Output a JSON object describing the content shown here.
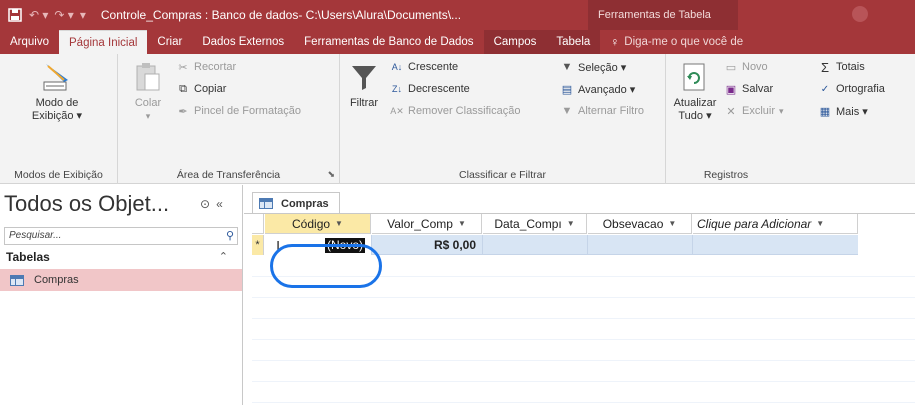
{
  "titlebar": {
    "title": "Controle_Compras : Banco de dados- C:\\Users\\Alura\\Documents\\...",
    "context_label": "Ferramentas de Tabela"
  },
  "tabs": [
    {
      "label": "Arquivo"
    },
    {
      "label": "Página Inicial"
    },
    {
      "label": "Criar"
    },
    {
      "label": "Dados Externos"
    },
    {
      "label": "Ferramentas de Banco de Dados"
    },
    {
      "label": "Campos"
    },
    {
      "label": "Tabela"
    },
    {
      "label": "Diga-me o que você de"
    }
  ],
  "ribbon": {
    "views": {
      "modo": "Modo de",
      "exibicao": "Exibição ▾",
      "group": "Modos de Exibição"
    },
    "clipboard": {
      "colar": "Colar",
      "recortar": "Recortar",
      "copiar": "Copiar",
      "pincel": "Pincel de Formatação",
      "group": "Área de Transferência"
    },
    "sort": {
      "filtrar": "Filtrar",
      "crescente": "Crescente",
      "decrescente": "Decrescente",
      "remover": "Remover Classificação",
      "selecao": "Seleção ▾",
      "avancado": "Avançado ▾",
      "alternar": "Alternar Filtro",
      "group": "Classificar e Filtrar"
    },
    "records": {
      "atualizar": "Atualizar",
      "tudo": "Tudo ▾",
      "novo": "Novo",
      "salvar": "Salvar",
      "excluir": "Excluir",
      "totais": "Totais",
      "ortografia": "Ortografia",
      "mais": "Mais ▾",
      "group": "Registros"
    }
  },
  "nav": {
    "title": "Todos os Objet...",
    "search_placeholder": "Pesquisar...",
    "category": "Tabelas",
    "item": "Compras"
  },
  "document": {
    "tab": "Compras",
    "columns": [
      "Código",
      "Valor_Comp",
      "Data_Compı",
      "Obsevacao",
      "Clique para Adicionar"
    ],
    "new_row": {
      "selector": "*",
      "codigo": "(Novo)",
      "valor": "R$ 0,00"
    }
  },
  "colors": {
    "access_red": "#a4373a",
    "selected_row": "#d8e5f4",
    "highlight": "#1a73e8"
  }
}
